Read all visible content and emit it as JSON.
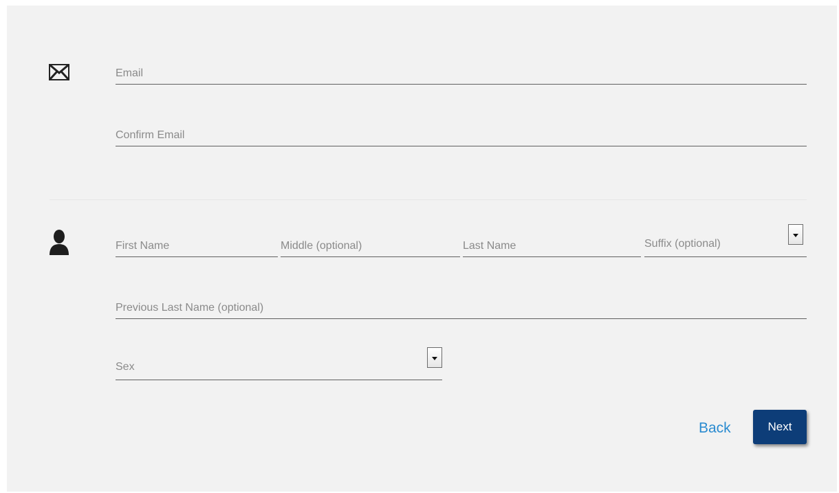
{
  "contact": {
    "email_placeholder": "Email",
    "confirm_email_placeholder": "Confirm Email"
  },
  "name": {
    "first_placeholder": "First Name",
    "middle_placeholder": "Middle (optional)",
    "last_placeholder": "Last Name",
    "suffix_label": "Suffix (optional)",
    "previous_last_placeholder": "Previous Last Name (optional)",
    "sex_label": "Sex"
  },
  "actions": {
    "back_label": "Back",
    "next_label": "Next"
  },
  "icons": {
    "contact_section": "envelope-icon",
    "name_section": "person-icon",
    "dropdown": "caret-down-icon"
  },
  "colors": {
    "panel_background": "#f2f2f2",
    "link": "#2a8bd0",
    "primary_button": "#0d3d78",
    "underline": "#5f5f5f"
  }
}
